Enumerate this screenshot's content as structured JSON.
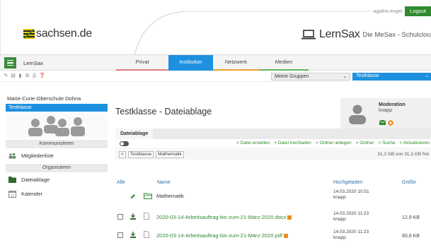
{
  "header": {
    "username": "agathe.engel",
    "logout_label": "Logout",
    "logo_text": "sachsen.de",
    "brand_name": "LernSax",
    "brand_sub": "Die MeSax - Schulcloud"
  },
  "nav": {
    "app_label": "LernSax",
    "tabs": [
      {
        "label": "Privat",
        "color": "#e07a7a"
      },
      {
        "label": "Institution",
        "color": "#1e90e0"
      },
      {
        "label": "Netzwerk",
        "color": "#f0a030"
      },
      {
        "label": "Medien",
        "color": "#5cb85c"
      }
    ],
    "active_tab": "Institution"
  },
  "toolbar": {
    "icons": [
      "clipboard-icon",
      "note-icon",
      "bookmark-icon",
      "export-icon",
      "print-icon",
      "help-icon"
    ],
    "groups_select": "Meine Gruppen",
    "class_select": "Testklasse"
  },
  "sidebar": {
    "school": "Marie-Curie-Oberschule Dohna",
    "active_group": "Testklasse",
    "sections": [
      {
        "title": "Kommunizieren",
        "items": [
          {
            "label": "Mitgliederliste",
            "icon": "members-icon"
          }
        ]
      },
      {
        "title": "Organisieren",
        "items": [
          {
            "label": "Dateiablage",
            "icon": "files-icon"
          },
          {
            "label": "Kalender",
            "icon": "calendar-icon"
          }
        ]
      }
    ]
  },
  "main": {
    "title": "Testklasse - Dateiablage",
    "moderation_title": "Moderation",
    "moderation_name": "knapp",
    "tab_label": "Dateiablage",
    "actions": [
      "> Datei erstellen",
      "> Datei hochladen",
      "> Ordner anlegen",
      "> Ordner",
      "> Suche",
      "> Aktualisieren"
    ],
    "breadcrumbs": [
      "<",
      "Testklasse",
      "Mathematik"
    ],
    "quota": "31,2 GB von 31,3 GB frei",
    "columns": {
      "all": "Alle",
      "name": "Name",
      "uploaded": "Hochgeladen",
      "size": "Größe"
    },
    "rows": [
      {
        "type": "folder",
        "name": "Mathematik",
        "uploaded": "14.03.2020 10:51",
        "by": "knapp",
        "size": ""
      },
      {
        "type": "file",
        "name": "2020-03-14-Arbeitsauftrag-bis-zum-21-März-2020.docx",
        "uploaded": "14.03.2020 11:23",
        "by": "knapp",
        "size": "12,9 KB"
      },
      {
        "type": "file",
        "name": "2020-03-14-Arbeitsauftrag-bis-zum-21-März-2020.pdf",
        "uploaded": "14.03.2020 11:23",
        "by": "knapp",
        "size": "60,8 KB"
      }
    ]
  }
}
